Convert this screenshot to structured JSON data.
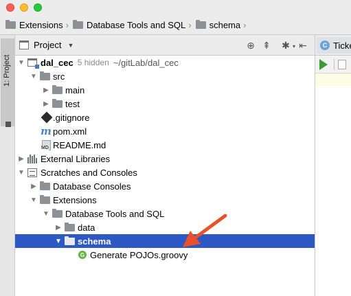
{
  "breadcrumb": [
    {
      "label": "Extensions"
    },
    {
      "label": "Database Tools and SQL"
    },
    {
      "label": "schema"
    }
  ],
  "side_stripe": {
    "label": "1: Project"
  },
  "panel": {
    "view_label": "Project",
    "header_icons": [
      "target-icon",
      "collapse-all-icon",
      "settings-icon",
      "hide-panel-icon"
    ]
  },
  "tree": {
    "root": {
      "label": "dal_cec",
      "hint": "5 hidden",
      "path": "~/gitLab/dal_cec"
    },
    "src": "src",
    "main": "main",
    "test": "test",
    "gitignore": ".gitignore",
    "pom": "pom.xml",
    "readme": "README.md",
    "ext_libs": "External Libraries",
    "scratches": "Scratches and Consoles",
    "db_consoles": "Database Consoles",
    "extensions": "Extensions",
    "db_tools": "Database Tools and SQL",
    "data": "data",
    "schema": "schema",
    "gen_pojos": "Generate POJOs.groovy"
  },
  "editor": {
    "tab_label": "Ticke"
  },
  "colors": {
    "selection": "#2e58c4",
    "annotation_arrow": "#e8512a",
    "run_green": "#3c9a3b"
  }
}
